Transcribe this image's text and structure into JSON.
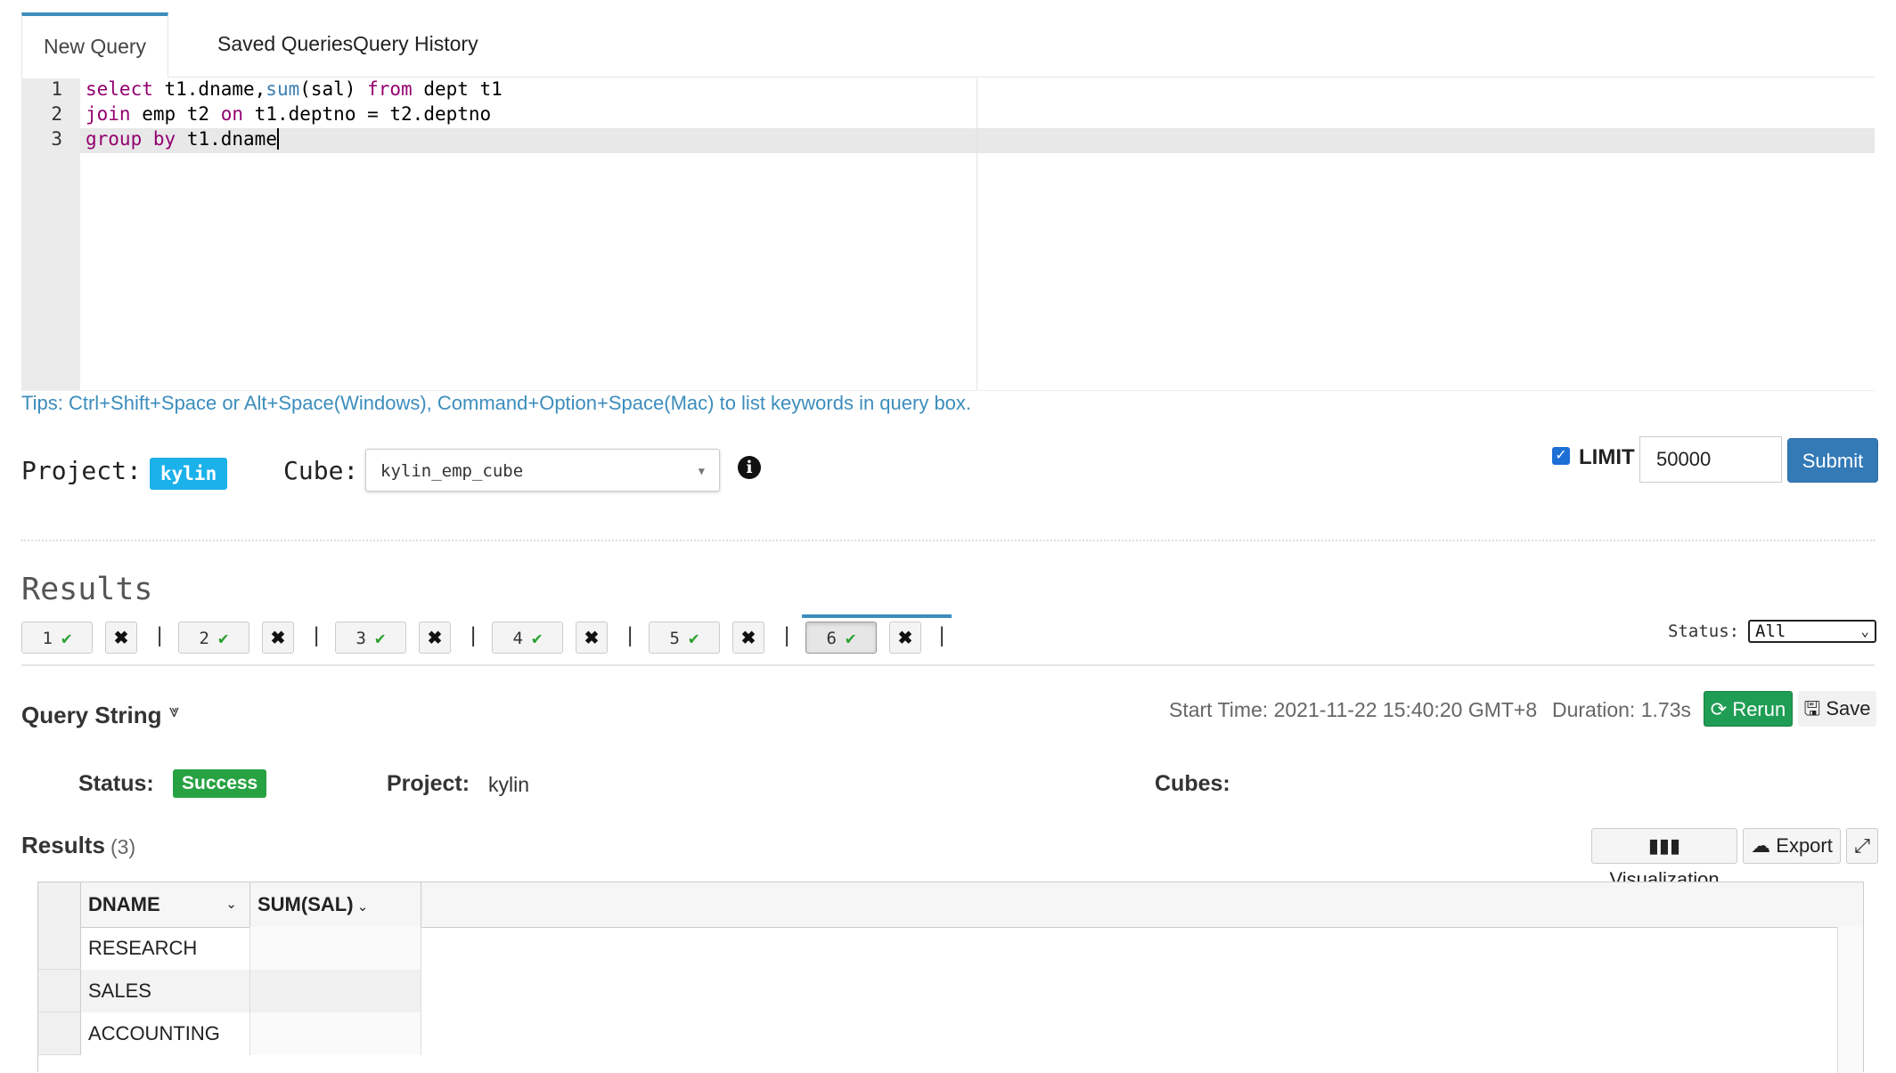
{
  "tabs": [
    "New Query",
    "Saved Queries",
    "Query History"
  ],
  "editor": {
    "line_numbers": [
      "1",
      "2",
      "3"
    ],
    "lines": [
      [
        [
          "kw",
          "select"
        ],
        [
          "t",
          " t1.dname,"
        ],
        [
          "fn",
          "sum"
        ],
        [
          "t",
          "(sal) "
        ],
        [
          "kw",
          "from"
        ],
        [
          "t",
          " dept t1"
        ]
      ],
      [
        [
          "kw",
          "join"
        ],
        [
          "t",
          " emp t2 "
        ],
        [
          "kw",
          "on"
        ],
        [
          "t",
          " t1.deptno = t2.deptno"
        ]
      ],
      [
        [
          "kw",
          "group"
        ],
        [
          "t",
          " "
        ],
        [
          "kw",
          "by"
        ],
        [
          "t",
          " t1.dname"
        ]
      ]
    ]
  },
  "tips": "Tips: Ctrl+Shift+Space or Alt+Space(Windows), Command+Option+Space(Mac) to list keywords in query box.",
  "project_label": "Project:",
  "project_name": "kylin",
  "cube_label": "Cube:",
  "cube_value": "kylin_emp_cube",
  "limit_label": "LIMIT",
  "limit_value": "50000",
  "submit_label": "Submit",
  "results_title": "Results",
  "query_tabs": [
    "1",
    "2",
    "3",
    "4",
    "5",
    "6"
  ],
  "status_filter_label": "Status:",
  "status_filter_value": "All",
  "query_string_label": "Query String",
  "start_time": "Start Time: 2021-11-22 15:40:20 GMT+8",
  "duration": "Duration: 1.73s",
  "rerun_label": "Rerun",
  "save_label": "Save",
  "status_label": "Status:",
  "status_value": "Success",
  "project_label2": "Project:",
  "project_value": "kylin",
  "cubes_label": "Cubes:",
  "results2_title": "Results",
  "results2_count": "(3)",
  "visualization_label": "Visualization",
  "export_label": "Export",
  "columns": [
    "DNAME",
    "SUM(SAL)"
  ],
  "rows": [
    [
      "RESEARCH",
      ""
    ],
    [
      "SALES",
      ""
    ],
    [
      "ACCOUNTING",
      ""
    ]
  ],
  "colors": {
    "accent": "#3c8dbc",
    "success": "#27a243",
    "submit": "#337ab7",
    "project_badge": "#1bb1ea"
  }
}
